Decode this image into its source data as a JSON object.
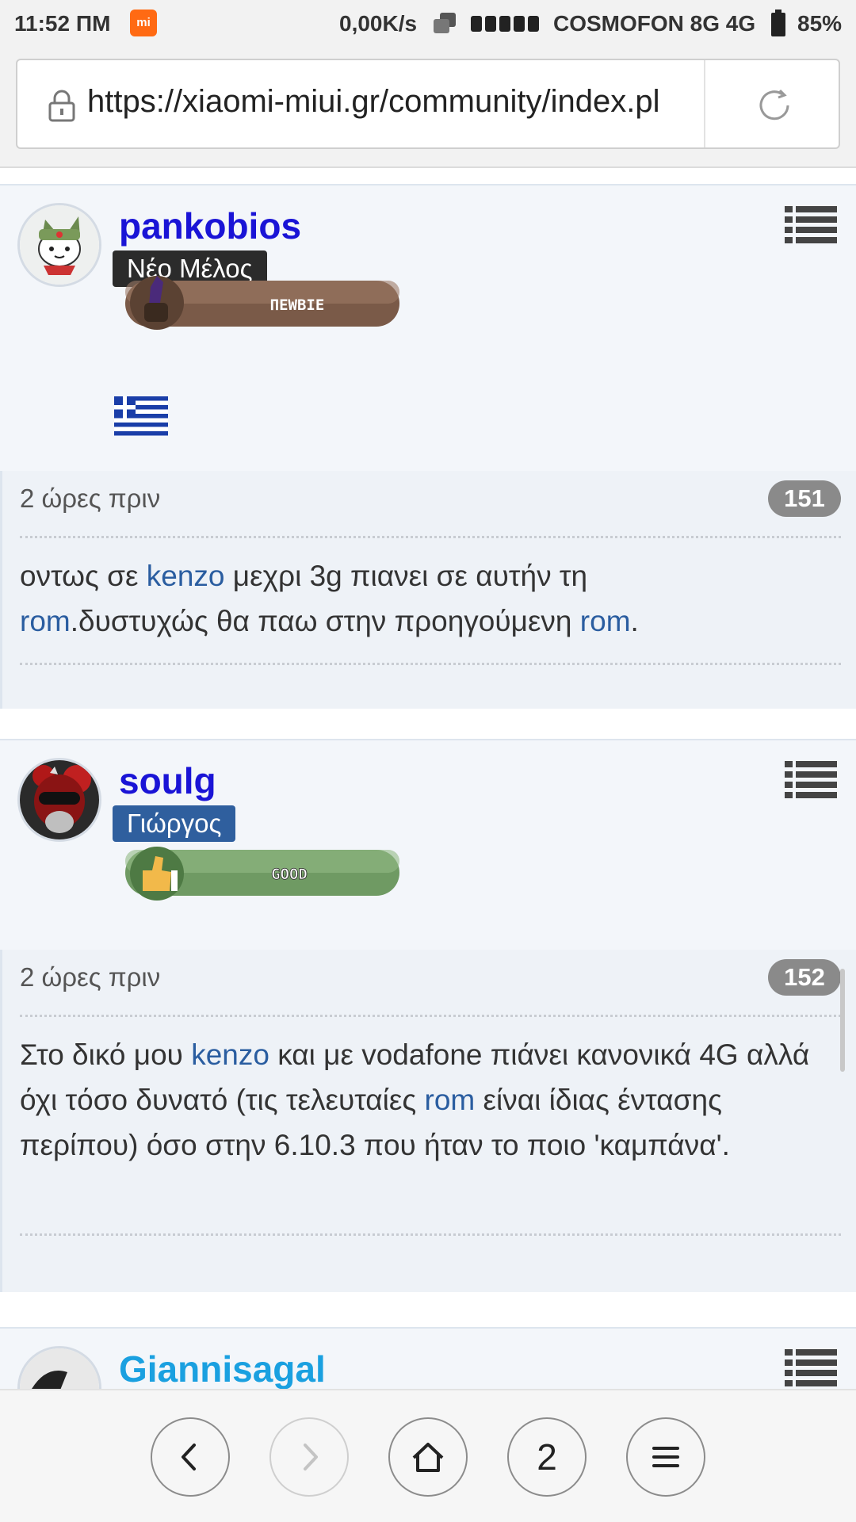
{
  "status_bar": {
    "time": "11:52 ΠΜ",
    "speed": "0,00K/s",
    "carrier": "COSMOFON 8G  4G",
    "battery": "85%"
  },
  "browser": {
    "url": "https://xiaomi-miui.gr/community/index.pl"
  },
  "posts": [
    {
      "username": "pankobios",
      "rank": "Νέο Μέλος",
      "rank_color": "#2b2b2b",
      "badge_text": "ΠΕWBIE",
      "time": "2 ώρες πριν",
      "post_number": "151",
      "text_parts": [
        {
          "t": "οντως σε "
        },
        {
          "t": "kenzo"
        },
        {
          "t": " μεχρι 3g πιανει σε αυτήν τη "
        },
        {
          "t": "rom"
        },
        {
          "t": ".δυστυχώς θα παω στην προηγούμενη "
        },
        {
          "t": "rom"
        },
        {
          "t": "."
        }
      ]
    },
    {
      "username": "soulg",
      "rank": "Γιώργος",
      "rank_color": "#2f5f9e",
      "badge_text": "GOOD",
      "time": "2 ώρες πριν",
      "post_number": "152",
      "text_parts": [
        {
          "t": "Στο δικό μου "
        },
        {
          "t": "kenzo"
        },
        {
          "t": " και με vodafone πιάνει κανονικά 4G αλλά όχι τόσο δυνατό (τις τελευταίες "
        },
        {
          "t": "rom"
        },
        {
          "t": " είναι ίδιας έντασης περίπου) όσο στην 6.10.3 που ήταν το ποιο 'καμπάνα'."
        }
      ]
    },
    {
      "username": "Giannisagal",
      "username_color": "#1aa0e0"
    }
  ],
  "bottom_nav": {
    "tab_count": "2"
  }
}
